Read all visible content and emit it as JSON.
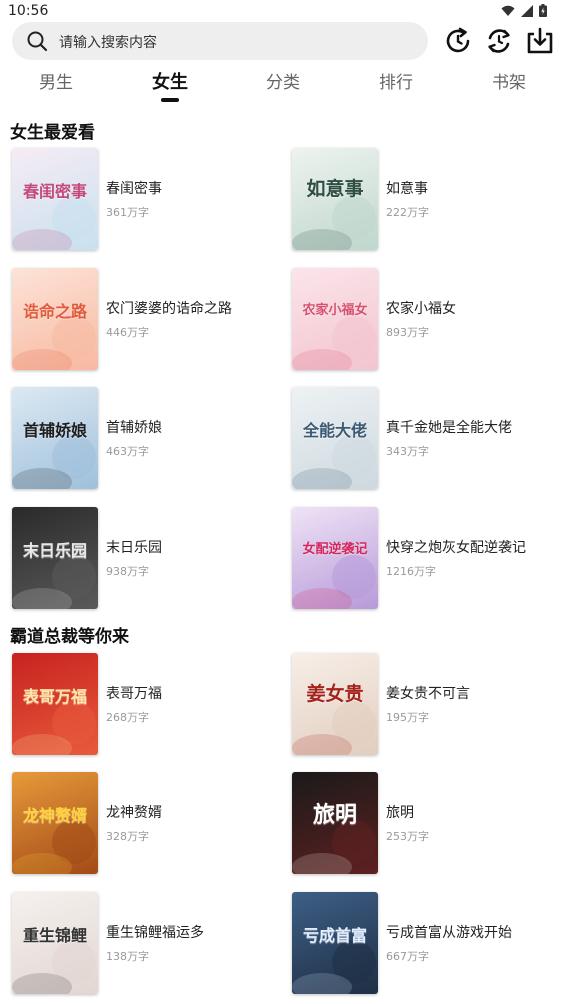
{
  "status": {
    "time": "10:56"
  },
  "search": {
    "placeholder": "请输入搜索内容"
  },
  "tabs": [
    {
      "label": "男生"
    },
    {
      "label": "女生"
    },
    {
      "label": "分类"
    },
    {
      "label": "排行"
    },
    {
      "label": "书架"
    }
  ],
  "active_tab": "女生",
  "sections": [
    {
      "title": "女生最爱看",
      "books": [
        {
          "title": "春闺密事",
          "words": "361万字",
          "cover_text": "春闺密事",
          "colors": [
            "#f6ecf4",
            "#c9e0ef",
            "#c34a7a"
          ]
        },
        {
          "title": "如意事",
          "words": "222万字",
          "cover_text": "如意事",
          "colors": [
            "#eef3ef",
            "#bfd7cd",
            "#2f4f44"
          ]
        },
        {
          "title": "农门婆婆的诰命之路",
          "words": "446万字",
          "cover_text": "诰命之路",
          "colors": [
            "#fde3d8",
            "#f7b9a0",
            "#e15b3b"
          ]
        },
        {
          "title": "农家小福女",
          "words": "893万字",
          "cover_text": "农家小福女",
          "colors": [
            "#fbe5ea",
            "#f3c4cf",
            "#d8506e"
          ]
        },
        {
          "title": "首辅娇娘",
          "words": "463万字",
          "cover_text": "首辅娇娘",
          "colors": [
            "#dce9f3",
            "#9fc0db",
            "#1e1e1e"
          ]
        },
        {
          "title": "真千金她是全能大佬",
          "words": "343万字",
          "cover_text": "全能大佬",
          "colors": [
            "#eef2f4",
            "#cdd9df",
            "#3d5a75"
          ]
        },
        {
          "title": "末日乐园",
          "words": "938万字",
          "cover_text": "末日乐园",
          "colors": [
            "#2a2a2a",
            "#5a5a5a",
            "#e8e8e8"
          ]
        },
        {
          "title": "快穿之炮灰女配逆袭记",
          "words": "1216万字",
          "cover_text": "女配逆袭记",
          "colors": [
            "#efe3f6",
            "#b79ad9",
            "#d6285b"
          ]
        }
      ]
    },
    {
      "title": "霸道总裁等你来",
      "books": [
        {
          "title": "表哥万福",
          "words": "268万字",
          "cover_text": "表哥万福",
          "colors": [
            "#c7231f",
            "#e85a3c",
            "#ffe7a6"
          ]
        },
        {
          "title": "姜女贵不可言",
          "words": "195万字",
          "cover_text": "姜女贵",
          "colors": [
            "#f7efe8",
            "#e2cdbf",
            "#a5231d"
          ]
        },
        {
          "title": "龙神赘婿",
          "words": "328万字",
          "cover_text": "龙神赘婿",
          "colors": [
            "#e79a3a",
            "#a34a18",
            "#ffd23a"
          ]
        },
        {
          "title": "旅明",
          "words": "253万字",
          "cover_text": "旅明",
          "colors": [
            "#1a1a1a",
            "#5e2020",
            "#ffffff"
          ]
        },
        {
          "title": "重生锦鲤福运多",
          "words": "138万字",
          "cover_text": "重生锦鲤",
          "colors": [
            "#f5f1ee",
            "#e1d6d2",
            "#333333"
          ]
        },
        {
          "title": "亏成首富从游戏开始",
          "words": "667万字",
          "cover_text": "亏成首富",
          "colors": [
            "#3d5f86",
            "#1f2f45",
            "#dfeeff"
          ]
        }
      ]
    }
  ]
}
